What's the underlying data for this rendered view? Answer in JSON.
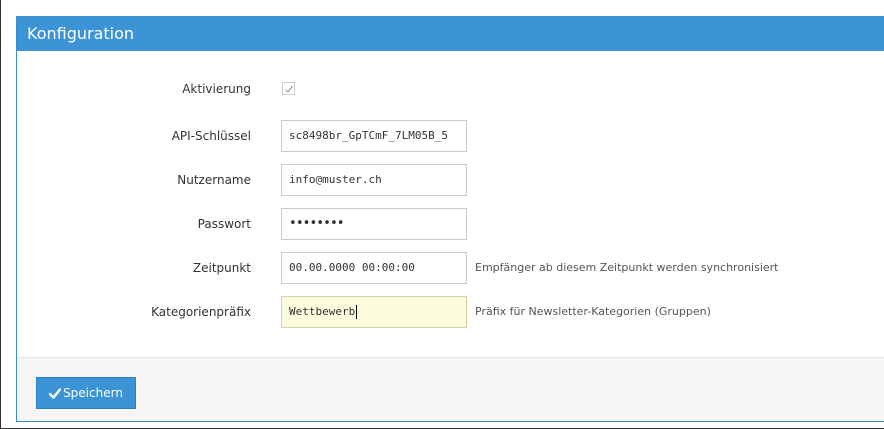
{
  "panel": {
    "title": "Konfiguration"
  },
  "form": {
    "activation": {
      "label": "Aktivierung",
      "checked": true
    },
    "api_key": {
      "label": "API-Schlüssel",
      "value": "sc8498br_GpTCmF_7LM05B_5"
    },
    "username": {
      "label": "Nutzername",
      "value": "info@muster.ch"
    },
    "password": {
      "label": "Passwort",
      "value": "••••••••"
    },
    "timestamp": {
      "label": "Zeitpunkt",
      "value": "00.00.0000 00:00:00",
      "help": "Empfänger ab diesem Zeitpunkt werden synchronisiert"
    },
    "category_prefix": {
      "label": "Kategorienpräfix",
      "value": "Wettbewerb",
      "help": "Präfix für Newsletter-Kategorien (Gruppen)"
    }
  },
  "footer": {
    "save_label": "Speichern"
  },
  "colors": {
    "accent": "#3c94d6",
    "active_field": "#fcfcdc",
    "footer_bg": "#f5f5f5"
  }
}
